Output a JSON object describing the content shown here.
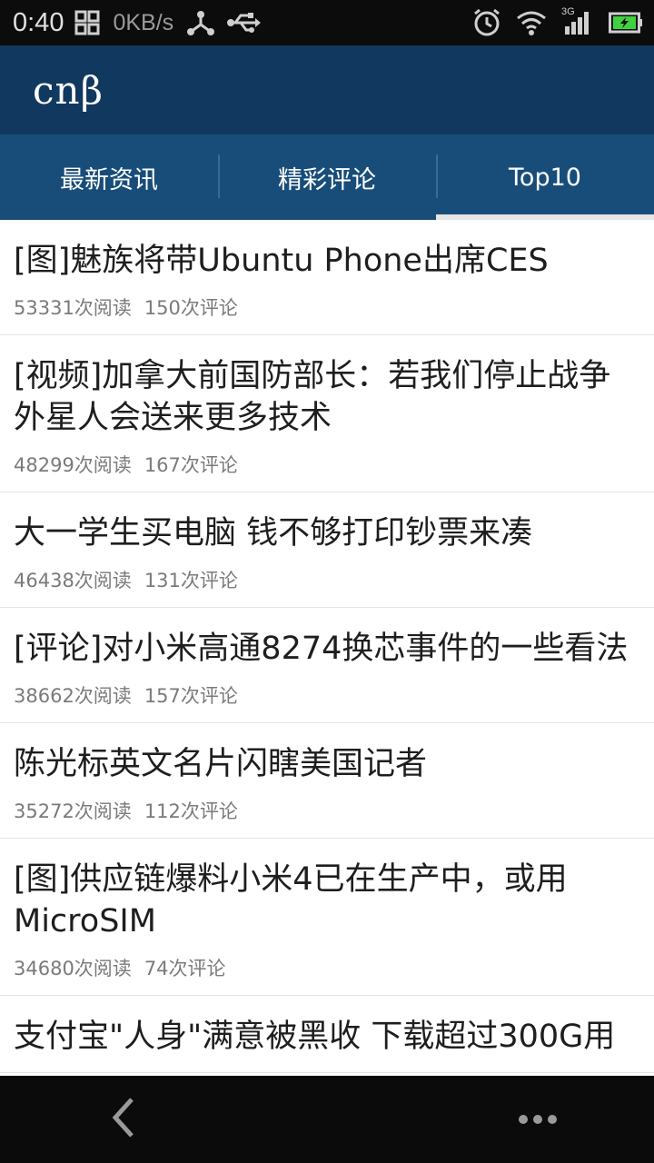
{
  "status_bar": {
    "time": "0:40",
    "network_speed": "0KB/s",
    "network_type": "3G",
    "icons": [
      "grid-icon",
      "share-icon",
      "usb-icon",
      "alarm-icon",
      "wifi-icon",
      "signal-icon",
      "battery-icon"
    ]
  },
  "header": {
    "logo": "cnβ"
  },
  "tabs": [
    {
      "label": "最新资讯",
      "active": false
    },
    {
      "label": "精彩评论",
      "active": false
    },
    {
      "label": "Top10",
      "active": true
    }
  ],
  "articles": [
    {
      "title": "[图]魅族将带Ubuntu Phone出席CES",
      "reads": "53331次阅读",
      "comments": "150次评论"
    },
    {
      "title": "[视频]加拿大前国防部长：若我们停止战争外星人会送来更多技术",
      "reads": "48299次阅读",
      "comments": "167次评论"
    },
    {
      "title": "大一学生买电脑 钱不够打印钞票来凑",
      "reads": "46438次阅读",
      "comments": "131次评论"
    },
    {
      "title": "[评论]对小米高通8274换芯事件的一些看法",
      "reads": "38662次阅读",
      "comments": "157次评论"
    },
    {
      "title": "陈光标英文名片闪瞎美国记者",
      "reads": "35272次阅读",
      "comments": "112次评论"
    },
    {
      "title": "[图]供应链爆料小米4已在生产中，或用MicroSIM",
      "reads": "34680次阅读",
      "comments": "74次评论"
    },
    {
      "title": "支付宝\"人身\"满意被黑收 下载超过300G用",
      "reads": "",
      "comments": ""
    }
  ],
  "colors": {
    "header_bg": "#11385f",
    "tabs_bg": "#184d7a",
    "status_bg": "#0c0c0c",
    "battery": "#3fd13f"
  }
}
